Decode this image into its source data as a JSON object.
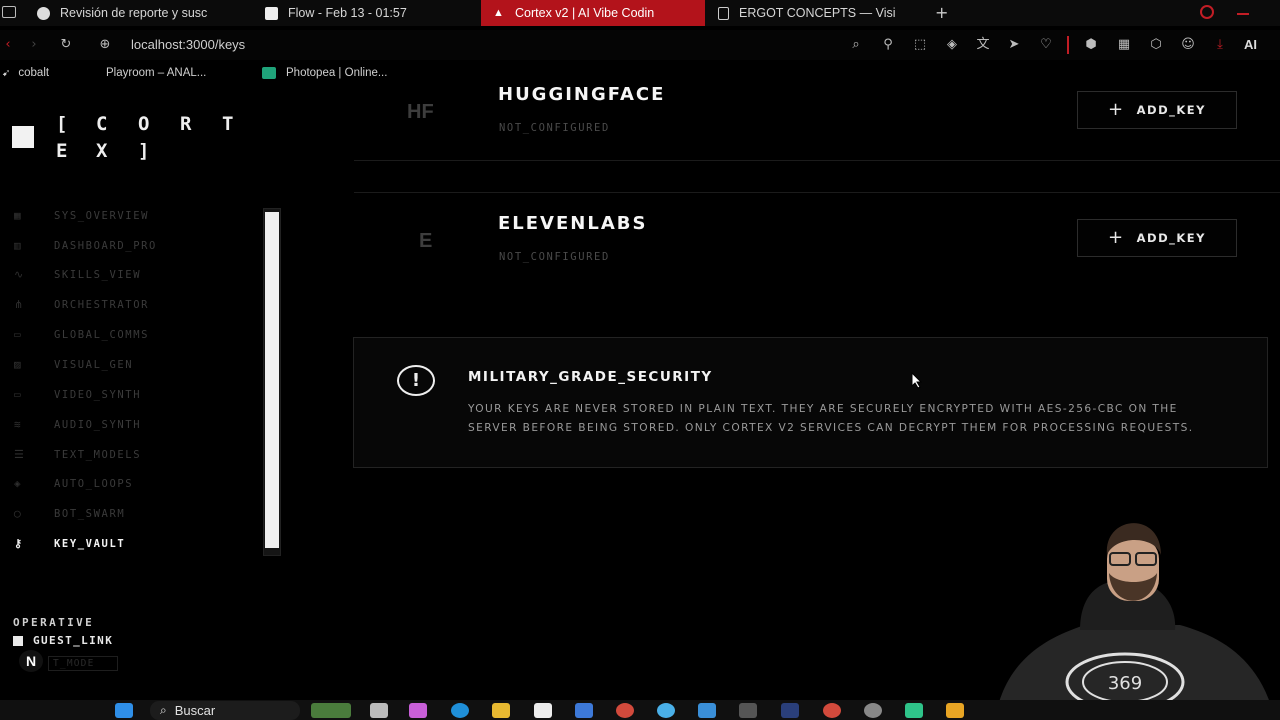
{
  "browser": {
    "tabs": [
      {
        "label": "Revisión de reporte y susc",
        "active": false
      },
      {
        "label": "Flow - Feb 13 - 01:57",
        "active": false
      },
      {
        "label": "Cortex v2 | AI Vibe Codin",
        "active": true
      },
      {
        "label": "ERGOT CONCEPTS — Visi",
        "active": false
      }
    ],
    "new_tab": "+",
    "url": "localhost:3000/keys",
    "ai_label": "AI",
    "bookmarks": [
      "cobalt",
      "Playroom – ANAL...",
      "Photopea | Online..."
    ]
  },
  "sidebar": {
    "logo_letters": [
      "[",
      "C",
      "O",
      "R",
      "T",
      "E",
      "X",
      "]"
    ],
    "items": [
      {
        "label": "SYS_OVERVIEW",
        "icon": "grid-icon",
        "active": false
      },
      {
        "label": "DASHBOARD_PRO",
        "icon": "chart-icon",
        "active": false
      },
      {
        "label": "SKILLS_VIEW",
        "icon": "pulse-icon",
        "active": false
      },
      {
        "label": "ORCHESTRATOR",
        "icon": "flow-icon",
        "active": false
      },
      {
        "label": "GLOBAL_COMMS",
        "icon": "chat-icon",
        "active": false
      },
      {
        "label": "VISUAL_GEN",
        "icon": "image-icon",
        "active": false
      },
      {
        "label": "VIDEO_SYNTH",
        "icon": "video-icon",
        "active": false
      },
      {
        "label": "AUDIO_SYNTH",
        "icon": "audio-icon",
        "active": false
      },
      {
        "label": "TEXT_MODELS",
        "icon": "text-icon",
        "active": false
      },
      {
        "label": "AUTO_LOOPS",
        "icon": "layers-icon",
        "active": false
      },
      {
        "label": "BOT_SWARM",
        "icon": "bot-icon",
        "active": false
      },
      {
        "label": "KEY_VAULT",
        "icon": "key-icon",
        "active": true
      }
    ],
    "operative_label": "OPERATIVE",
    "guest_link": "GUEST_LINK",
    "mode_label": "T_MODE"
  },
  "providers": [
    {
      "abbr": "HF",
      "name": "HUGGINGFACE",
      "status": "NOT_CONFIGURED",
      "button": "ADD_KEY"
    },
    {
      "abbr": "E",
      "name": "ELEVENLABS",
      "status": "NOT_CONFIGURED",
      "button": "ADD_KEY"
    }
  ],
  "security": {
    "title": "MILITARY_GRADE_SECURITY",
    "line1": "YOUR KEYS ARE NEVER STORED IN PLAIN TEXT. THEY ARE SECURELY ENCRYPTED WITH AES-256-CBC ON THE",
    "line2": "SERVER BEFORE BEING STORED. ONLY CORTEX V2 SERVICES CAN DECRYPT THEM FOR PROCESSING REQUESTS."
  },
  "taskbar": {
    "search_label": "Buscar"
  },
  "webcam": {
    "logo_text": "369"
  },
  "colors": {
    "active_tab": "#b3131b",
    "background": "#000000",
    "text": "#f4f4f4"
  }
}
